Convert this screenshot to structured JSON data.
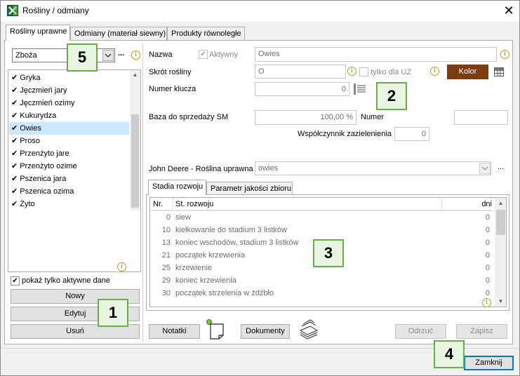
{
  "window": {
    "title": "Rośliny / odmiany",
    "close_glyph": "✕",
    "app_icon": "excel-like-icon"
  },
  "tabs": [
    {
      "label": "Rośliny uprawne",
      "active": true
    },
    {
      "label": "Odmiany (materiał siewny)",
      "active": false
    },
    {
      "label": "Produkty równoległe",
      "active": false
    }
  ],
  "left": {
    "group_combo_value": "Zboża",
    "more_label": "...",
    "info_glyph": "i",
    "items": [
      {
        "label": "Gryka",
        "active": true
      },
      {
        "label": "Jęczmień jary",
        "active": true
      },
      {
        "label": "Jęczmień ozimy",
        "active": true
      },
      {
        "label": "Kukurydza",
        "active": true
      },
      {
        "label": "Owies",
        "active": true,
        "selected": true
      },
      {
        "label": "Proso",
        "active": true
      },
      {
        "label": "Przenżyto jare",
        "active": true
      },
      {
        "label": "Przenżyto ozime",
        "active": true
      },
      {
        "label": "Pszenica jara",
        "active": true
      },
      {
        "label": "Pszenica ozima",
        "active": true
      },
      {
        "label": "Żyto",
        "active": true
      }
    ],
    "check_glyph": "✔",
    "show_active_label": "pokaż tylko aktywne dane",
    "show_active_checked": true,
    "buttons": {
      "new": "Nowy",
      "edit": "Edytuj",
      "delete": "Usuń"
    }
  },
  "form": {
    "name_label": "Nazwa",
    "active_label": "Aktywny",
    "active_checked": true,
    "name_value": "Owies",
    "short_label": "Skrót rośliny",
    "short_value": "O",
    "uz_only_label": "tylko dla UZ",
    "uz_only_checked": false,
    "color_button": "Kolor",
    "color_swatch": "#7a3c10",
    "key_label": "Numer klucza",
    "key_value": "0",
    "sales_base_label": "Baza do sprzedaży SM",
    "sales_base_value": "100,00 %",
    "number_label": "Numer",
    "number_value": "",
    "greening_label": "Współczynnik zazielenienia",
    "greening_value": "0",
    "jd_label": "John Deere - Roślina uprawna",
    "jd_value": "owies",
    "jd_more": "..."
  },
  "subtabs": [
    {
      "label": "Stadia rozwoju",
      "active": true
    },
    {
      "label": "Parametr jakości zbioru",
      "active": false
    }
  ],
  "stages": {
    "headers": {
      "nr": "Nr.",
      "stage": "St. rozwoju",
      "days": "dni"
    },
    "rows": [
      {
        "nr": "0",
        "stage": "siew",
        "days": "0"
      },
      {
        "nr": "10",
        "stage": "kiełkowanie do stadium 3 listków",
        "days": "0"
      },
      {
        "nr": "13",
        "stage": "koniec wschodów, stadium 3 listków",
        "days": "0"
      },
      {
        "nr": "21",
        "stage": "początek krzewienia",
        "days": "0"
      },
      {
        "nr": "25",
        "stage": "krzewienie",
        "days": "0"
      },
      {
        "nr": "29",
        "stage": "koniec krzewienia",
        "days": "0"
      },
      {
        "nr": "30",
        "stage": "początek strzelenia w źdźbło",
        "days": "0"
      }
    ]
  },
  "bottom": {
    "notes_button": "Notatki",
    "documents_button": "Dokumenty",
    "cancel_button": "Odrzuć",
    "save_button": "Zapisz",
    "close_button": "Zamknij"
  },
  "callouts": {
    "c1": "1",
    "c2": "2",
    "c3": "3",
    "c4": "4",
    "c5": "5"
  },
  "colors": {
    "callout_border": "#6aab4a",
    "callout_fill": "#e9f5e3",
    "selection": "#cce8ff"
  }
}
